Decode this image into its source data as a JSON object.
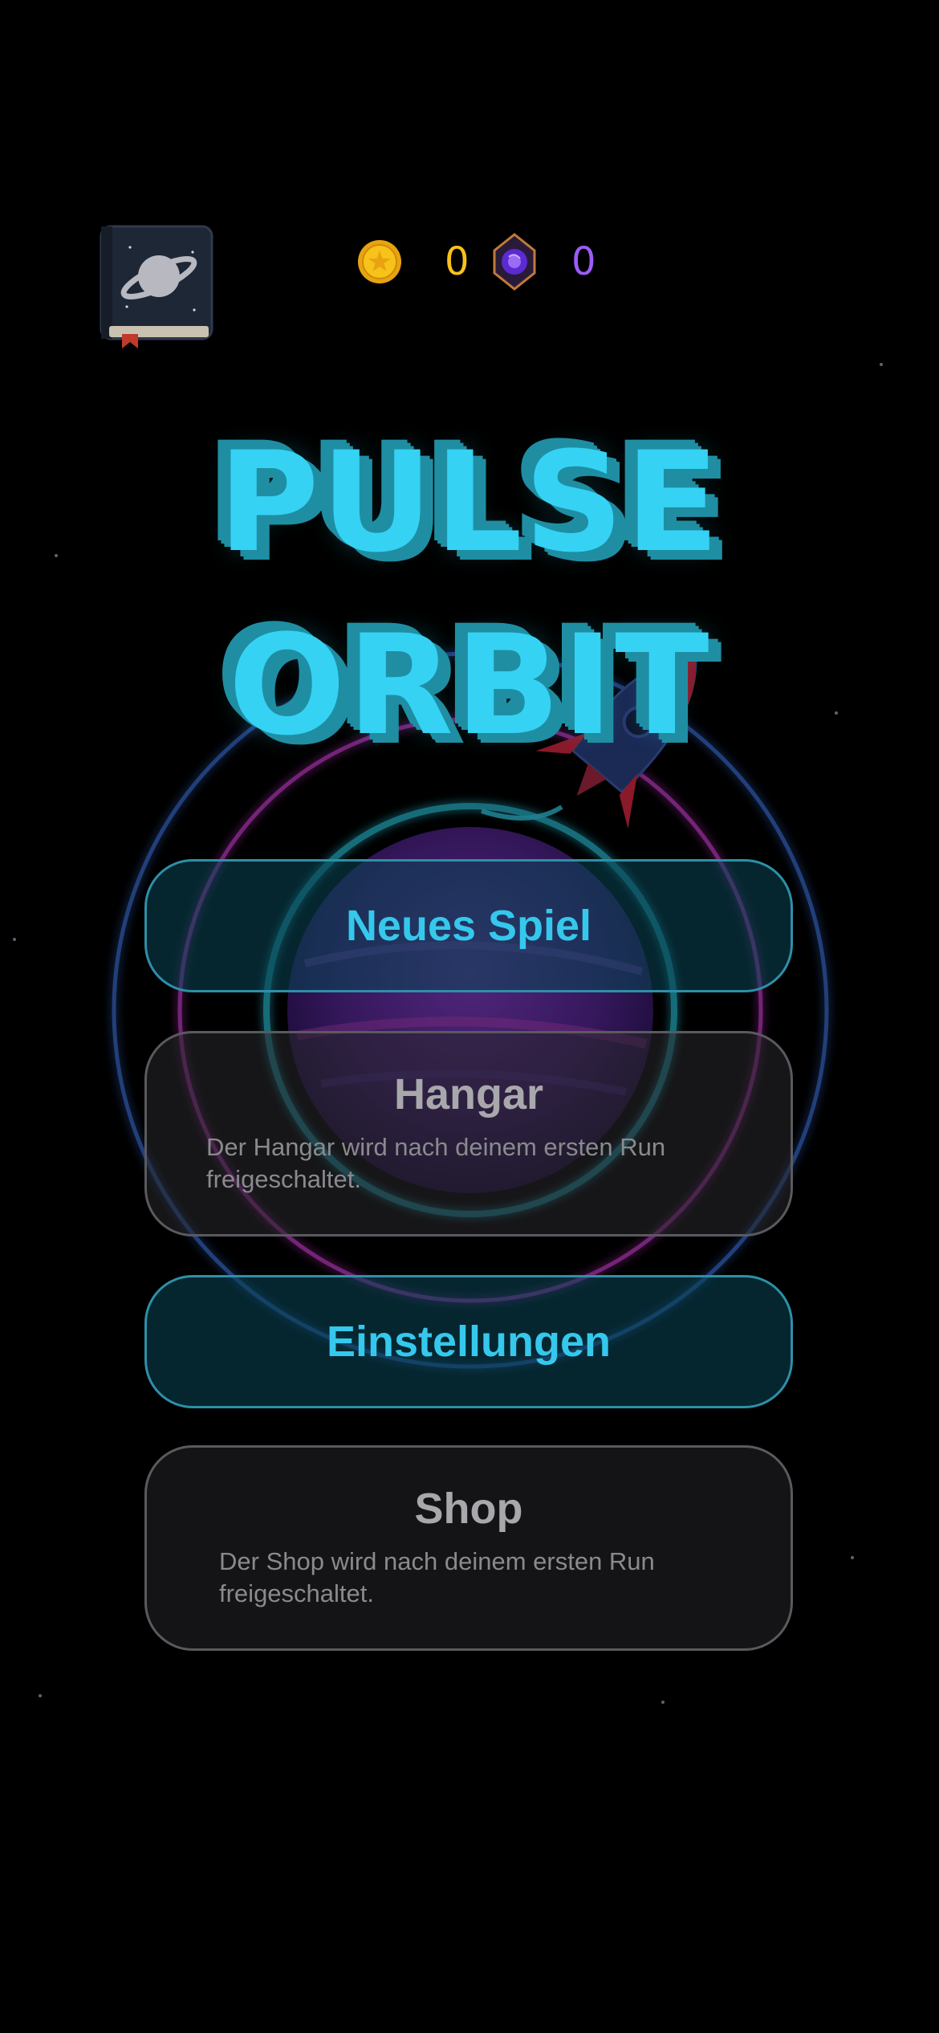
{
  "currencies": {
    "coins": {
      "value": "0",
      "icon": "gold-coin-icon",
      "color": "#f7c21a"
    },
    "gems": {
      "value": "0",
      "icon": "purple-gem-icon",
      "color": "#9b5cf6"
    }
  },
  "journal": {
    "icon": "planet-book-icon"
  },
  "title": {
    "line1": "PULSE",
    "line2": "ORBIT",
    "color": "#35d2f4",
    "shadow_color": "#1f8ea3"
  },
  "menu": {
    "new_game": {
      "label": "Neues Spiel",
      "locked": false
    },
    "hangar": {
      "label": "Hangar",
      "locked": true,
      "note": "Der Hangar wird nach deinem ersten Run freigeschaltet."
    },
    "settings": {
      "label": "Einstellungen",
      "locked": false
    },
    "shop": {
      "label": "Shop",
      "locked": true,
      "note": "Der Shop wird nach deinem ersten Run freigeschaltet."
    }
  }
}
